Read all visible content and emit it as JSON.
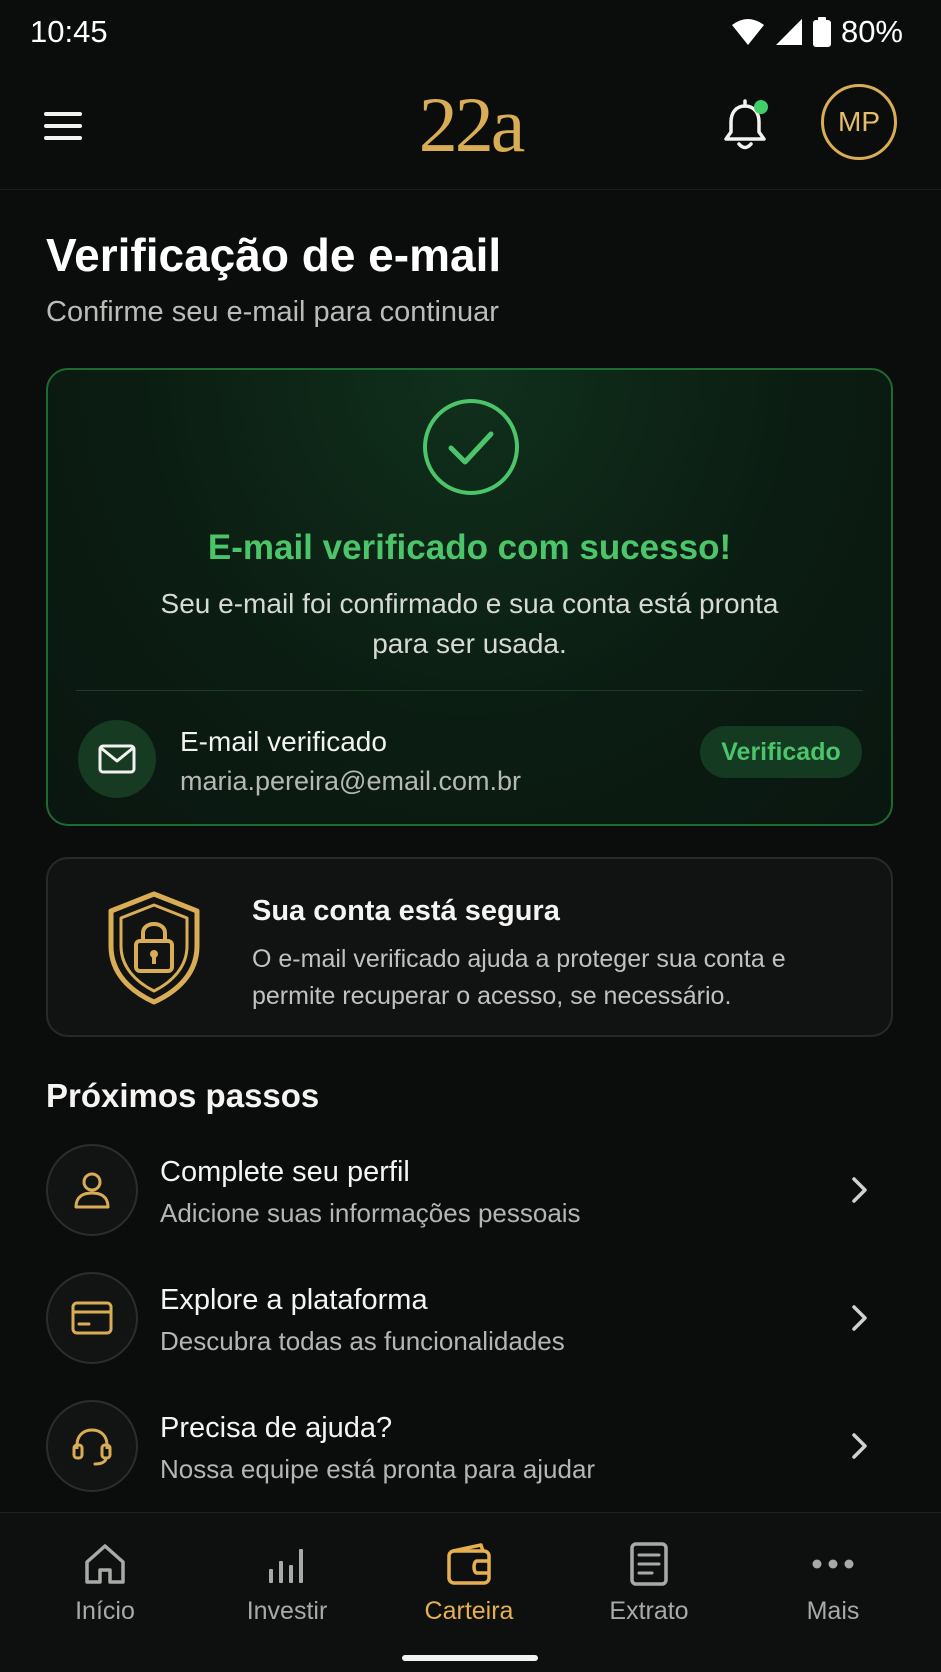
{
  "status_bar": {
    "time": "10:45",
    "battery": "80%"
  },
  "header": {
    "logo": "22a",
    "avatar_initials": "MP"
  },
  "page": {
    "title": "Verificação de e-mail",
    "subtitle": "Confirme seu e-mail para continuar"
  },
  "success_card": {
    "title": "E-mail verificado com sucesso!",
    "description": "Seu e-mail foi confirmado e sua conta está pronta para ser usada.",
    "email_label": "E-mail verificado",
    "email_value": "maria.pereira@email.com.br",
    "badge": "Verificado"
  },
  "security_card": {
    "title": "Sua conta está segura",
    "description": "O e-mail verificado ajuda a proteger sua conta e permite recuperar o acesso, se necessário."
  },
  "next_steps": {
    "title": "Próximos passos",
    "items": [
      {
        "icon": "user-icon",
        "title": "Complete seu perfil",
        "subtitle": "Adicione suas informações pessoais"
      },
      {
        "icon": "card-icon",
        "title": "Explore a plataforma",
        "subtitle": "Descubra todas as funcionalidades"
      },
      {
        "icon": "headset-icon",
        "title": "Precisa de ajuda?",
        "subtitle": "Nossa equipe está pronta para ajudar"
      }
    ]
  },
  "bottom_nav": {
    "active": "Carteira",
    "items": [
      {
        "icon": "home-icon",
        "label": "Início"
      },
      {
        "icon": "chart-bars-icon",
        "label": "Investir"
      },
      {
        "icon": "wallet-icon",
        "label": "Carteira"
      },
      {
        "icon": "document-icon",
        "label": "Extrato"
      },
      {
        "icon": "more-icon",
        "label": "Mais"
      }
    ]
  },
  "colors": {
    "accent_gold": "#d9ad55",
    "success_green": "#4cc46a",
    "background": "#0b0d0c"
  }
}
